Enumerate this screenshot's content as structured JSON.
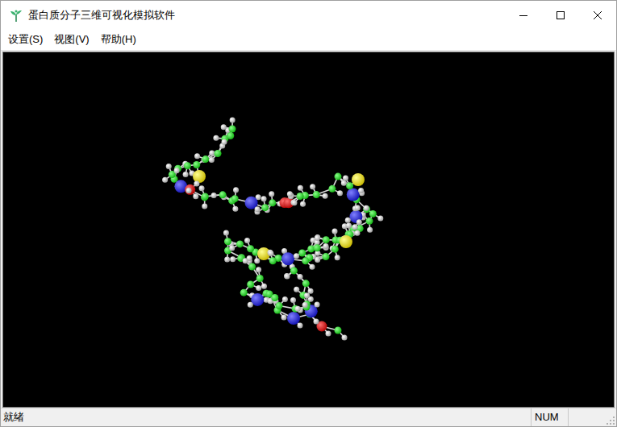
{
  "window": {
    "title": "蛋白质分子三维可视化模拟软件"
  },
  "menu": [
    "设置(S)",
    "视图(V)",
    "帮助(H)"
  ],
  "status_bar": {
    "message": "就绪",
    "indicators": [
      "NUM",
      ""
    ]
  }
}
